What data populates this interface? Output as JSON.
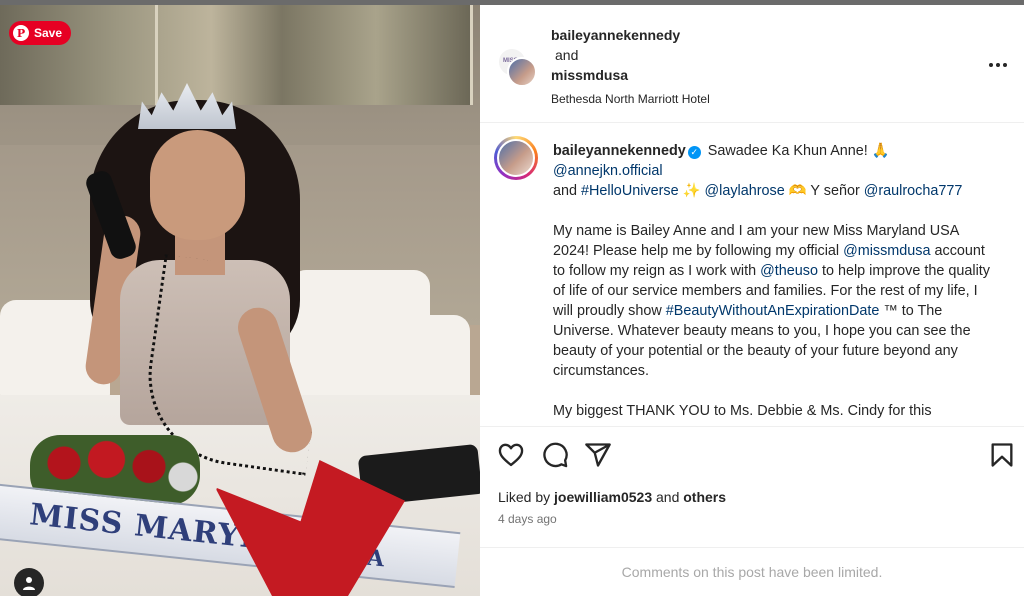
{
  "photo": {
    "save_label": "Save",
    "pin_letter": "P",
    "sash_text": "MISS MARYLAND",
    "sash_usa": "USA",
    "avatar_logo_text": "MISS"
  },
  "header": {
    "user1": "baileyannekennedy",
    "and": "and",
    "user2": "missmdusa",
    "location": "Bethesda North Marriott Hotel"
  },
  "caption": {
    "username": "baileyannekennedy",
    "verified_icon": "check",
    "line1_text": "Sawadee Ka Khun Anne! 🙏",
    "mention_annejkn": "@annejkn.official",
    "and_word": "and",
    "hashtag_hellouniverse": "#HelloUniverse",
    "emoji_sparkles": "✨",
    "mention_laylahrose": "@laylahrose",
    "emoji_heart_hands": "🫶",
    "y_senor": "Y señor",
    "mention_raulrocha": "@raulrocha777",
    "p2_part1": "My name is Bailey Anne and I am your new Miss Maryland USA 2024! Please help me by following my official",
    "mention_missmdusa": "@missmdusa",
    "p2_part2": "account to follow my reign as I work with",
    "mention_theuso": "@theuso",
    "p2_part3": "to help improve the quality of life of our service members and families. For the rest of my life, I will proudly show",
    "hashtag_beauty": "#BeautyWithoutAnExpirationDate",
    "p2_part4": "™ to The Universe. Whatever beauty means to you, I hope you can see the beauty of your potential or the beauty of your future beyond any circumstances.",
    "p3_text": "My biggest THANK YOU to Ms. Debbie & Ms. Cindy for this"
  },
  "actions": {
    "icons": [
      "heart-icon",
      "comment-icon",
      "share-icon",
      "bookmark-icon"
    ],
    "liked_prefix": "Liked by",
    "liked_user": "joewilliam0523",
    "liked_and": "and",
    "liked_others": "others",
    "time_ago": "4 days ago",
    "comments_limited": "Comments on this post have been limited."
  },
  "colors": {
    "pinterest_red": "#e60023",
    "link_blue": "#00376b",
    "verified_blue": "#0095f6",
    "muted_text": "#737373"
  }
}
